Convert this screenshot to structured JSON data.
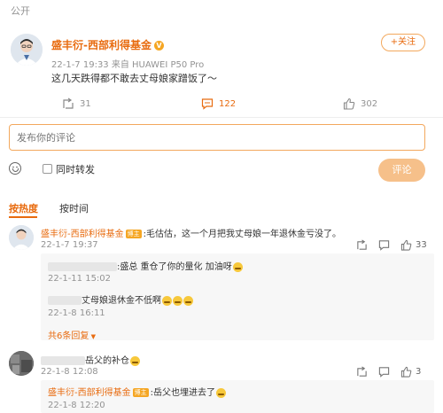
{
  "visibility": "公开",
  "post": {
    "author": "盛丰衍-西部利得基金",
    "meta": "22-1-7 19:33  来自 HUAWEI P50 Pro",
    "text": "这几天跌得都不敢去丈母娘家蹭饭了～",
    "follow_label": "+关注",
    "repost_count": "31",
    "comment_count": "122",
    "like_count": "302"
  },
  "composer": {
    "placeholder": "发布你的评论",
    "repost_label": "同时转发",
    "submit_label": "评论"
  },
  "tabs": {
    "hot": "按热度",
    "time": "按时间"
  },
  "comments": [
    {
      "author": "盛丰衍-西部利得基金",
      "tag": "博主",
      "text": ":毛估估，这一个月把我丈母娘一年退休金亏没了。",
      "time": "22-1-7 19:37",
      "like_count": "33",
      "replies": [
        {
          "text": ":盛总 重仓了你的量化 加油呀",
          "time": "22-1-11 15:02"
        },
        {
          "text": "丈母娘退休金不低啊",
          "time": "22-1-8 16:11"
        }
      ],
      "more_replies": "共6条回复"
    },
    {
      "text": "岳父的补仓",
      "time": "22-1-8 12:08",
      "like_count": "3",
      "replies": [
        {
          "author": "盛丰衍-西部利得基金",
          "tag": "博主",
          "text": ":岳父也埋进去了",
          "time": "22-1-8 12:20"
        }
      ]
    }
  ],
  "colors": {
    "accent": "#e86b0f",
    "submit_bg": "#f6c08a",
    "muted": "#939393"
  }
}
